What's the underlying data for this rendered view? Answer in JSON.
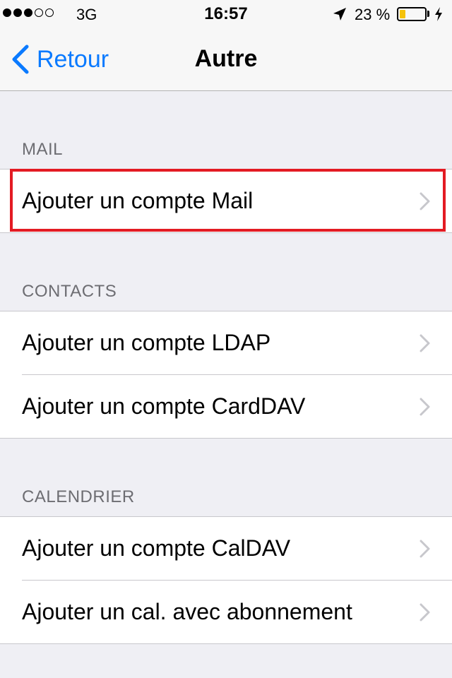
{
  "status_bar": {
    "carrier": "3G",
    "time": "16:57",
    "battery_percent_text": "23 %",
    "battery_level": 0.23,
    "signal_bars_filled": 3,
    "signal_bars_total": 5,
    "battery_color": "#f5c20a"
  },
  "nav": {
    "back_label": "Retour",
    "title": "Autre",
    "accent_color": "#0a7aff"
  },
  "sections": [
    {
      "header": "MAIL",
      "items": [
        {
          "label": "Ajouter un compte Mail",
          "highlighted": true
        }
      ]
    },
    {
      "header": "CONTACTS",
      "items": [
        {
          "label": "Ajouter un compte LDAP"
        },
        {
          "label": "Ajouter un compte CardDAV"
        }
      ]
    },
    {
      "header": "CALENDRIER",
      "items": [
        {
          "label": "Ajouter un compte CalDAV"
        },
        {
          "label": "Ajouter un cal. avec abonnement"
        }
      ]
    }
  ],
  "highlight_color": "#e31b23"
}
